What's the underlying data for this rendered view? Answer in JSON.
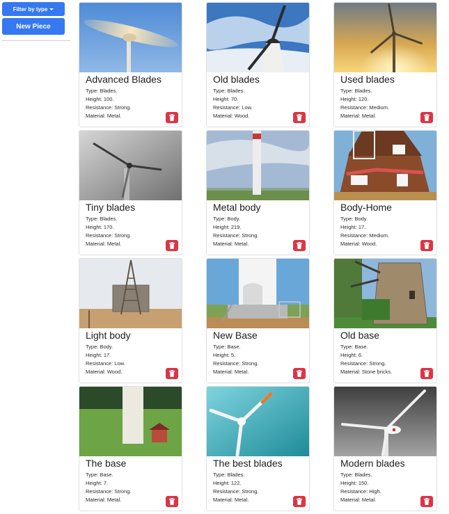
{
  "sidebar": {
    "filter_label": "Filter by type",
    "new_piece_label": "New Piece"
  },
  "labels": {
    "type": "Type:",
    "height": "Height:",
    "resistance": "Resistance:",
    "material": "Material:"
  },
  "colors": {
    "primary": "#3578f0",
    "danger": "#dc3545"
  },
  "cards": [
    {
      "title": "Advanced Blades",
      "type": "Blades.",
      "height": "100.",
      "resistance": "Strong.",
      "material": "Metal.",
      "scene": "blur-blades",
      "delete_icon": "trash-icon"
    },
    {
      "title": "Old blades",
      "type": "Blades.",
      "height": "70.",
      "resistance": "Low.",
      "material": "Wood.",
      "scene": "old-windmill",
      "delete_icon": "trash-icon"
    },
    {
      "title": "Used blades",
      "type": "Blades.",
      "height": "120.",
      "resistance": "Medium.",
      "material": "Metal.",
      "scene": "sunset-turbine",
      "delete_icon": "trash-icon"
    },
    {
      "title": "Tiny blades",
      "type": "Blades.",
      "height": "170.",
      "resistance": "Strong.",
      "material": "Metal.",
      "scene": "grey-turbine",
      "delete_icon": "trash-icon"
    },
    {
      "title": "Metal body",
      "type": "Body.",
      "height": "219.",
      "resistance": "Strong.",
      "material": "Metal.",
      "scene": "tower-field",
      "delete_icon": "trash-icon"
    },
    {
      "title": "Body-Home",
      "type": "Body.",
      "height": "17.",
      "resistance": "Medium.",
      "material": "Wood.",
      "scene": "wood-house",
      "delete_icon": "trash-icon"
    },
    {
      "title": "Light body",
      "type": "Body.",
      "height": "17.",
      "resistance": "Low.",
      "material": "Wood.",
      "scene": "lattice-tank",
      "delete_icon": "trash-icon"
    },
    {
      "title": "New Base",
      "type": "Base.",
      "height": "5.",
      "resistance": "Strong.",
      "material": "Metal.",
      "scene": "tower-base",
      "delete_icon": "trash-icon"
    },
    {
      "title": "Old base",
      "type": "Base.",
      "height": "6.",
      "resistance": "Strong.",
      "material": "Stone bricks.",
      "scene": "stone-mill",
      "delete_icon": "trash-icon"
    },
    {
      "title": "The base",
      "type": "Base.",
      "height": "7.",
      "resistance": "Strong.",
      "material": "Metal.",
      "scene": "green-field",
      "delete_icon": "trash-icon"
    },
    {
      "title": "The best blades",
      "type": "Blades.",
      "height": "122.",
      "resistance": "Strong.",
      "material": "Metal.",
      "scene": "teal-blades",
      "delete_icon": "trash-icon"
    },
    {
      "title": "Modern blades",
      "type": "Blades.",
      "height": "150.",
      "resistance": "High.",
      "material": "Metal.",
      "scene": "modern-hub",
      "delete_icon": "trash-icon"
    }
  ]
}
